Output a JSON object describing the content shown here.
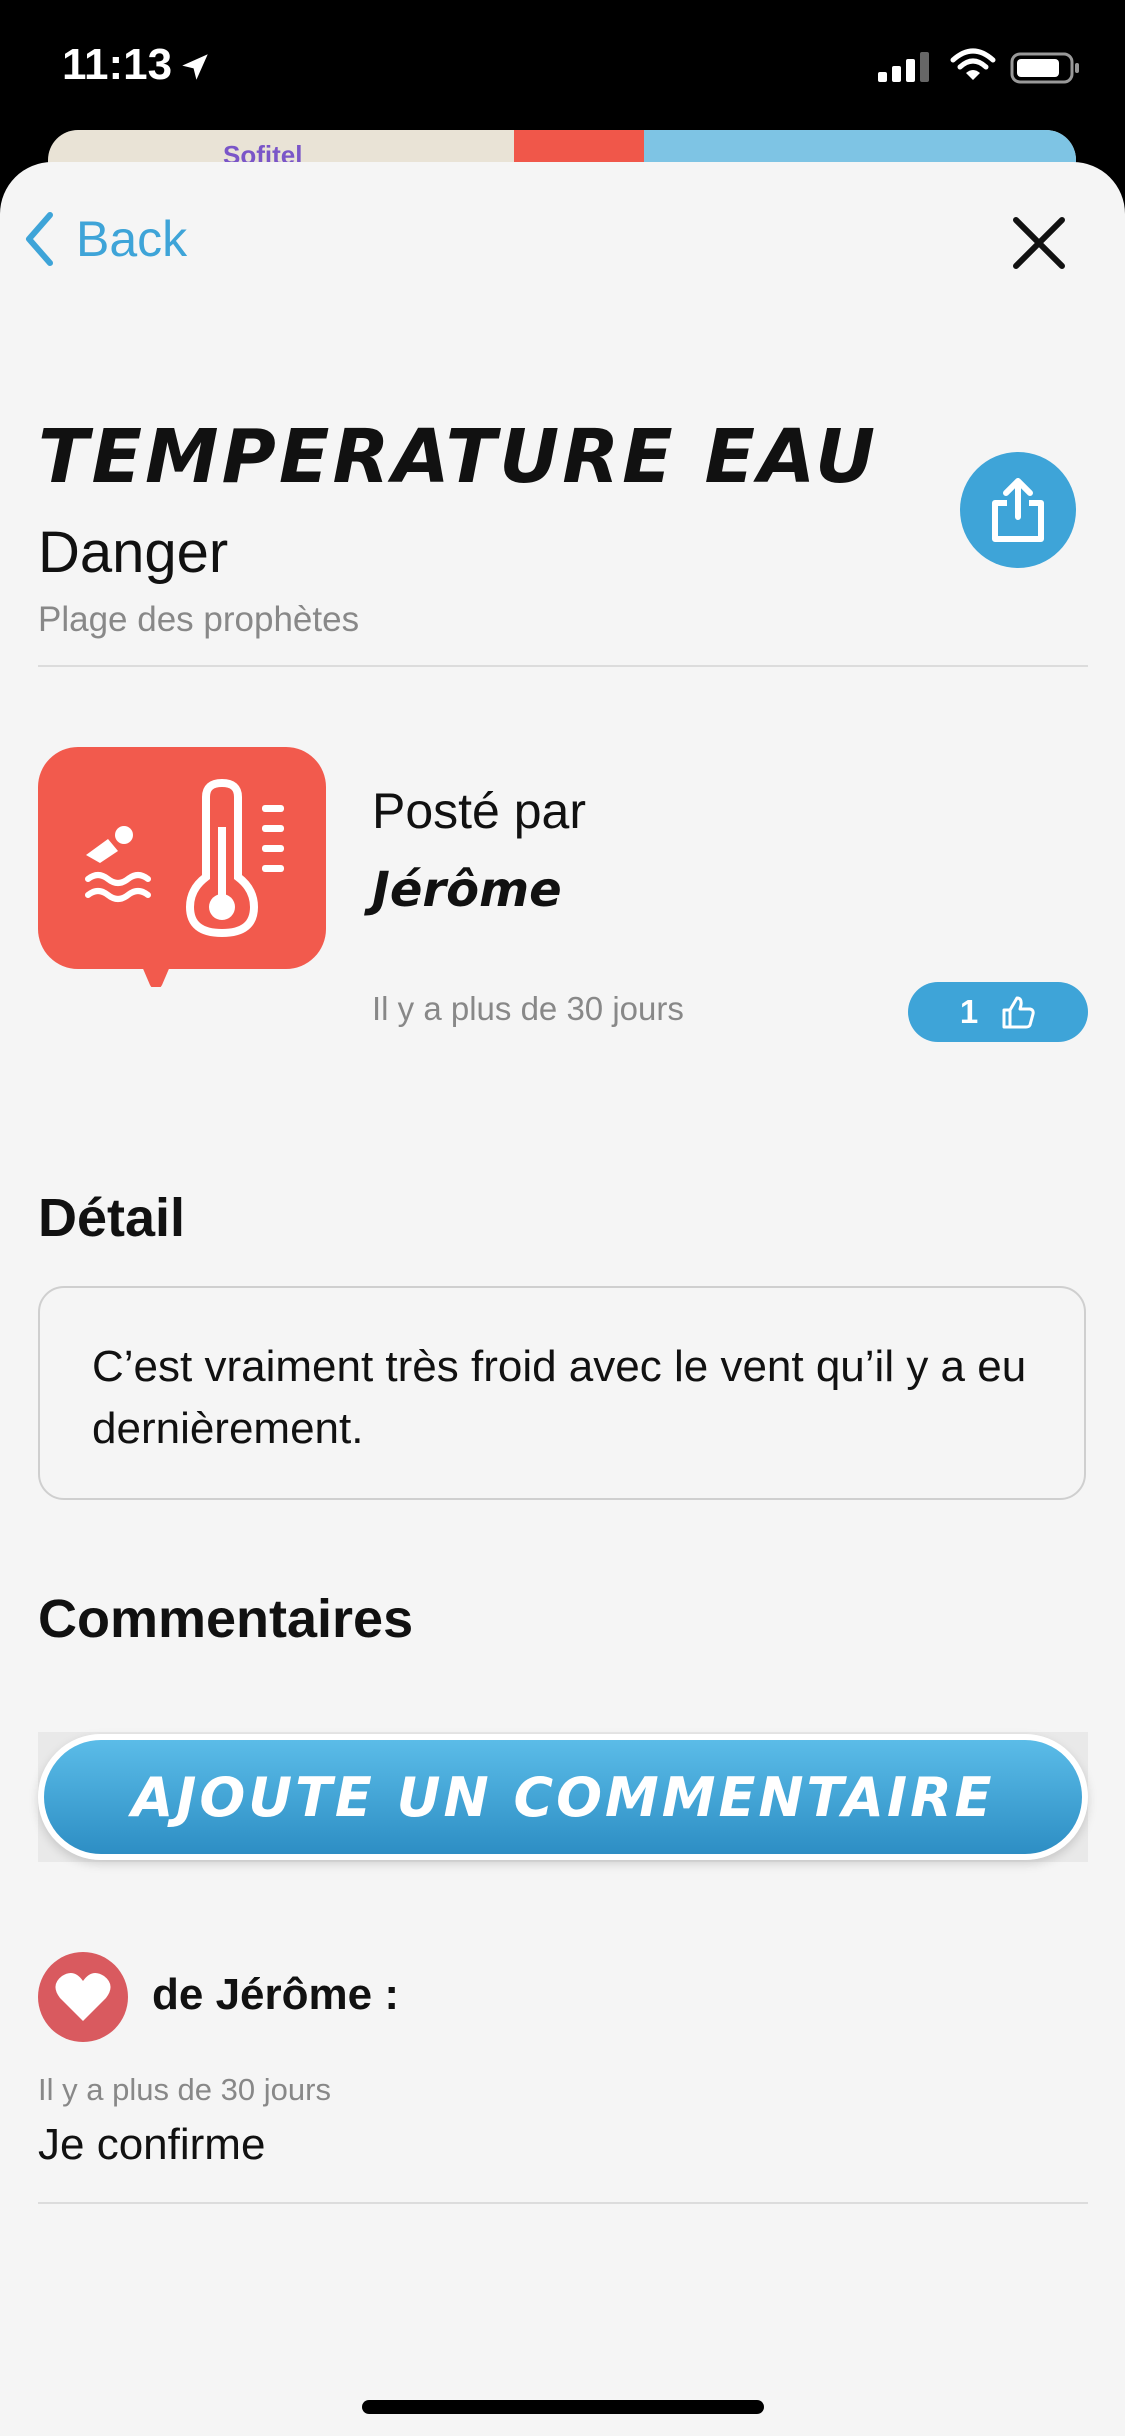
{
  "status_bar": {
    "time": "11:13"
  },
  "map": {
    "label": "Sofitel"
  },
  "nav": {
    "back_label": "Back"
  },
  "report": {
    "title": "Temperature eau",
    "category": "Danger",
    "place": "Plage des prophètes",
    "posted_by_label": "Posté par",
    "author": "Jérôme",
    "date": "Il y a plus de 30 jours",
    "likes": "1",
    "marker_color": "#f25a4d",
    "marker_icons": [
      "swimmer-icon",
      "thermometer-icon"
    ]
  },
  "detail": {
    "heading": "Détail",
    "text": "C’est vraiment très froid avec le vent qu’il y a eu dernièrement."
  },
  "comments": {
    "heading": "Commentaires",
    "add_button_label": "Ajoute un commentaire",
    "items": [
      {
        "author_line": "de Jérôme :",
        "date": "Il y a plus de 30 jours",
        "text": "Je confirme",
        "avatar_icon": "heart-icon"
      }
    ]
  },
  "colors": {
    "accent": "#3ea4d8",
    "danger": "#f25a4d",
    "avatar": "#d95a5f"
  }
}
